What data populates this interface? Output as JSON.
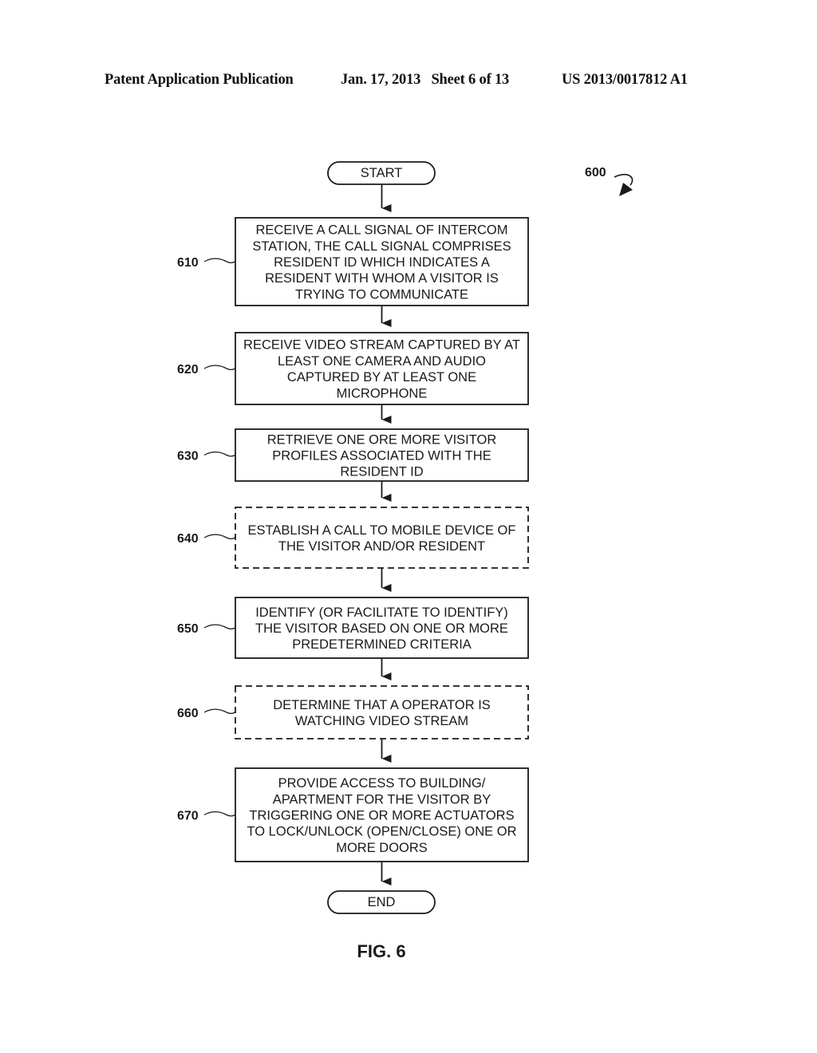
{
  "header": {
    "publication": "Patent Application Publication",
    "date_sheet": "Jan. 17, 2013   Sheet 6 of 13",
    "number": "US 2013/0017812 A1"
  },
  "diagram": {
    "ref": "600",
    "start_label": "START",
    "end_label": "END",
    "figure_label": "FIG. 6",
    "steps": [
      {
        "ref": "610",
        "style": "solid",
        "lines": [
          "RECEIVE A CALL SIGNAL OF INTERCOM",
          "STATION, THE CALL SIGNAL COMPRISES",
          "RESIDENT ID WHICH INDICATES A",
          "RESIDENT WITH WHOM A VISITOR IS",
          "TRYING TO COMMUNICATE"
        ]
      },
      {
        "ref": "620",
        "style": "solid",
        "lines": [
          "RECEIVE VIDEO STREAM CAPTURED BY AT",
          "LEAST ONE CAMERA AND AUDIO",
          "CAPTURED BY AT LEAST ONE",
          "MICROPHONE"
        ]
      },
      {
        "ref": "630",
        "style": "solid",
        "lines": [
          "RETRIEVE ONE ORE MORE VISITOR",
          "PROFILES ASSOCIATED WITH THE",
          "RESIDENT ID"
        ]
      },
      {
        "ref": "640",
        "style": "dashed",
        "lines": [
          "ESTABLISH A CALL TO MOBILE DEVICE OF",
          "THE VISITOR AND/OR RESIDENT"
        ]
      },
      {
        "ref": "650",
        "style": "solid",
        "lines": [
          "IDENTIFY (OR FACILITATE TO IDENTIFY)",
          "THE VISITOR BASED ON ONE OR MORE",
          "PREDETERMINED CRITERIA"
        ]
      },
      {
        "ref": "660",
        "style": "dashed",
        "lines": [
          "DETERMINE THAT A OPERATOR IS",
          "WATCHING VIDEO STREAM"
        ]
      },
      {
        "ref": "670",
        "style": "solid",
        "lines": [
          "PROVIDE ACCESS TO BUILDING/",
          "APARTMENT FOR THE VISITOR BY",
          "TRIGGERING ONE OR MORE ACTUATORS",
          "TO LOCK/UNLOCK (OPEN/CLOSE) ONE OR",
          "MORE DOORS"
        ]
      }
    ]
  }
}
